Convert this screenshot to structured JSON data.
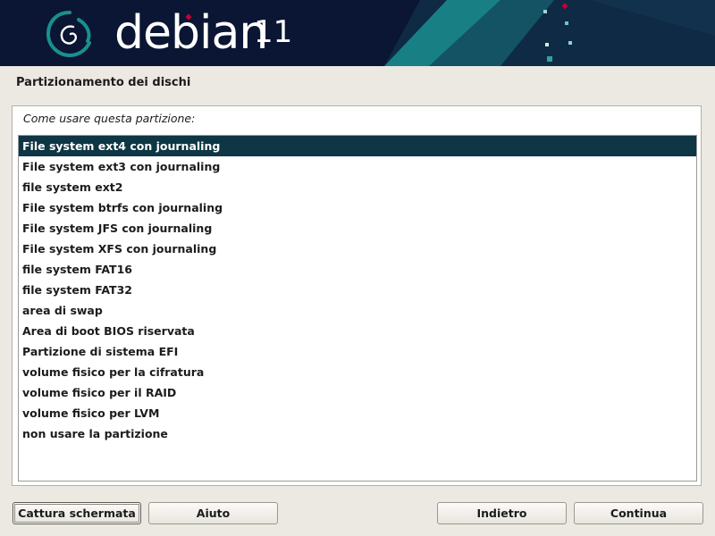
{
  "banner": {
    "brand": "debian",
    "version": "11"
  },
  "page": {
    "title": "Partizionamento dei dischi"
  },
  "question": {
    "prompt": "Come usare questa partizione:",
    "selected_index": 0,
    "options": [
      "File system ext4 con journaling",
      "File system ext3 con journaling",
      "file system ext2",
      "File system btrfs con journaling",
      "File system JFS con journaling",
      "File system XFS con journaling",
      "file system FAT16",
      "file system FAT32",
      "area di swap",
      "Area di boot BIOS riservata",
      "Partizione di sistema EFI",
      "volume fisico per la cifratura",
      "volume fisico per il RAID",
      "volume fisico per LVM",
      "non usare la partizione"
    ]
  },
  "buttons": {
    "screenshot": "Cattura schermata",
    "help": "Aiuto",
    "back": "Indietro",
    "continue": "Continua"
  },
  "colors": {
    "banner_bg": "#0a1633",
    "accent_teal": "#1a8f8f",
    "debian_red": "#c70036",
    "selection_bg": "#0e3644"
  }
}
